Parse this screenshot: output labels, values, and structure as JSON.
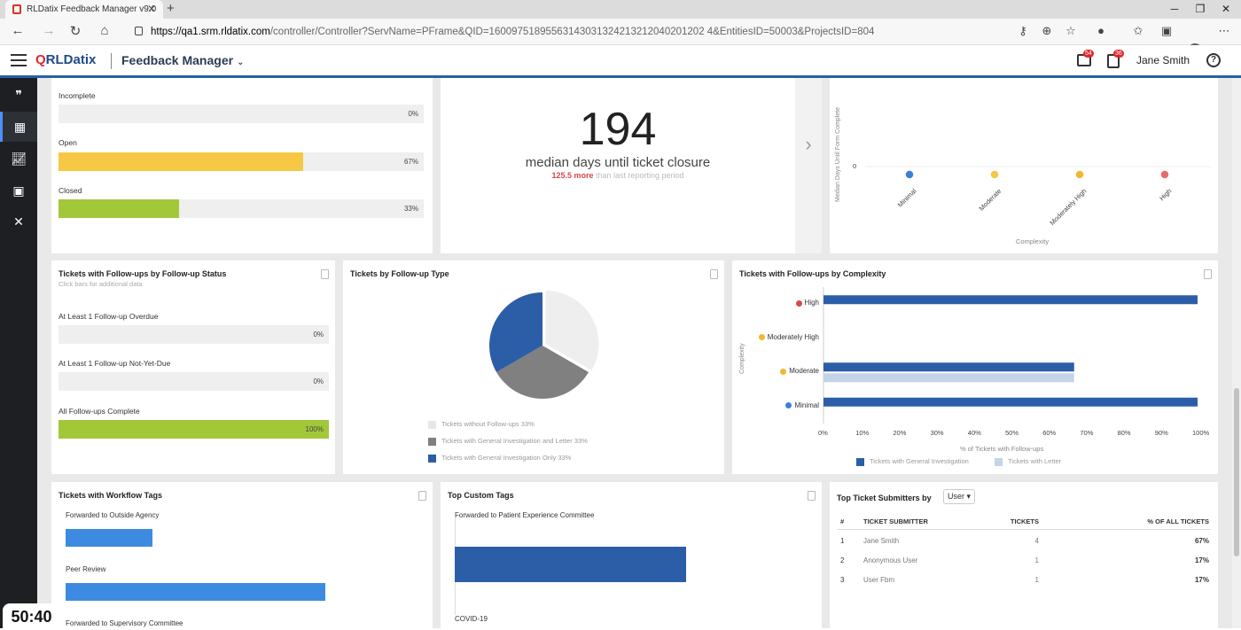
{
  "browser": {
    "tab_title": "RLDatix Feedback Manager v9.0",
    "url_host": "https://qa1.srm.rldatix.com",
    "url_path": "/controller/Controller?ServName=PFrame&QID=16009751895563143031324213212040201202 4&EntitiesID=50003&ProjectsID=804"
  },
  "app": {
    "logo_text": "RLDatix",
    "product": "Feedback Manager",
    "user": "Jane Smith",
    "badge_1": "54",
    "badge_2": "36"
  },
  "colors": {
    "accent": "#2461a8",
    "yellow": "#f7c844",
    "green": "#a2c739",
    "blue": "#2c5ea8",
    "light_blue": "#c5d3e8",
    "bar_blue": "#3d8be0",
    "red": "#d64a4a"
  },
  "status_card": {
    "rows": [
      {
        "label": "Incomplete",
        "pct": "0%",
        "value": 0
      },
      {
        "label": "Open",
        "pct": "67%",
        "value": 67
      },
      {
        "label": "Closed",
        "pct": "33%",
        "value": 33
      }
    ]
  },
  "median_card": {
    "number": "194",
    "label": "median days until ticket closure",
    "delta": "125.5 more",
    "delta_tail": "than last reporting period"
  },
  "complexity_top": {
    "ylabel": "Median Days Until Form Complete",
    "zero": "0",
    "xlabel": "Complexity",
    "categories": [
      "Minimal",
      "Moderate",
      "Moderately High",
      "High"
    ]
  },
  "followup_status": {
    "title": "Tickets with Follow-ups by Follow-up Status",
    "subtitle": "Click bars for additional data",
    "rows": [
      {
        "label": "At Least 1 Follow-up Overdue",
        "pct": "0%",
        "value": 0
      },
      {
        "label": "At Least 1 Follow-up Not-Yet-Due",
        "pct": "0%",
        "value": 0
      },
      {
        "label": "All Follow-ups Complete",
        "pct": "100%",
        "value": 100
      }
    ]
  },
  "followup_type": {
    "title": "Tickets by Follow-up Type"
  },
  "complexity_bars": {
    "title": "Tickets with Follow-ups by Complexity",
    "ylabel": "Complexity",
    "xlabel": "% of Tickets with Follow-ups",
    "ticks": [
      "0%",
      "10%",
      "20%",
      "30%",
      "40%",
      "50%",
      "60%",
      "70%",
      "80%",
      "90%",
      "100%"
    ]
  },
  "workflow_tags": {
    "title": "Tickets with Workflow Tags"
  },
  "custom_tags": {
    "title": "Top Custom Tags"
  },
  "submitters": {
    "title": "Top Ticket Submitters by",
    "select": "User",
    "columns": [
      "#",
      "TICKET SUBMITTER",
      "TICKETS",
      "% OF ALL TICKETS"
    ],
    "rows": [
      {
        "n": "1",
        "name": "Jane Smith",
        "tickets": "4",
        "pct": "67%"
      },
      {
        "n": "2",
        "name": "Anonymous User",
        "tickets": "1",
        "pct": "17%"
      },
      {
        "n": "3",
        "name": "User Fbm",
        "tickets": "1",
        "pct": "17%"
      }
    ]
  },
  "overlay": {
    "timer": "50:40"
  },
  "chart_data": [
    {
      "type": "pie",
      "title": "Tickets by Follow-up Type",
      "series": [
        {
          "name": "Tickets without Follow-ups",
          "label": "33%",
          "value": 33.3,
          "color": "#eeeeee"
        },
        {
          "name": "Tickets with General Investigation and Letter",
          "label": "33%",
          "value": 33.3,
          "color": "#808080"
        },
        {
          "name": "Tickets with General Investigation Only",
          "label": "33%",
          "value": 33.3,
          "color": "#2c5ea8"
        }
      ]
    },
    {
      "type": "bar",
      "orientation": "horizontal",
      "title": "Tickets with Follow-ups by Complexity",
      "xlabel": "% of Tickets with Follow-ups",
      "ylabel": "Complexity",
      "xlim": [
        0,
        100
      ],
      "categories": [
        {
          "name": "High",
          "dot": "#d64a4a"
        },
        {
          "name": "Moderately High",
          "dot": "#f2b630"
        },
        {
          "name": "Moderate",
          "dot": "#f2b630"
        },
        {
          "name": "Minimal",
          "dot": "#3d7fd6"
        }
      ],
      "series": [
        {
          "name": "Tickets with General Investigation",
          "color": "#2c5ea8",
          "values": [
            100,
            0,
            67,
            100
          ]
        },
        {
          "name": "Tickets with Letter",
          "color": "#c5d3e8",
          "values": [
            0,
            0,
            67,
            0
          ]
        }
      ]
    },
    {
      "type": "scatter",
      "title": "",
      "xlabel": "Complexity",
      "ylabel": "Median Days Until Form Complete",
      "categories": [
        "Minimal",
        "Moderate",
        "Moderately High",
        "High"
      ],
      "values": [
        0,
        0,
        0,
        0
      ],
      "colors": [
        "#3d7fd6",
        "#f2c844",
        "#f2b630",
        "#e86a6a"
      ]
    },
    {
      "type": "bar",
      "orientation": "vertical",
      "title": "Tickets with Workflow Tags",
      "categories": [
        "Forwarded to Outside Agency",
        "Peer Review",
        "Forwarded to Supervisory Committee"
      ],
      "values": [
        1,
        3,
        null
      ]
    },
    {
      "type": "bar",
      "orientation": "vertical",
      "title": "Top Custom Tags",
      "categories": [
        "Forwarded to Patient Experience Committee",
        "COVID-19"
      ],
      "values": [
        1,
        null
      ]
    }
  ]
}
